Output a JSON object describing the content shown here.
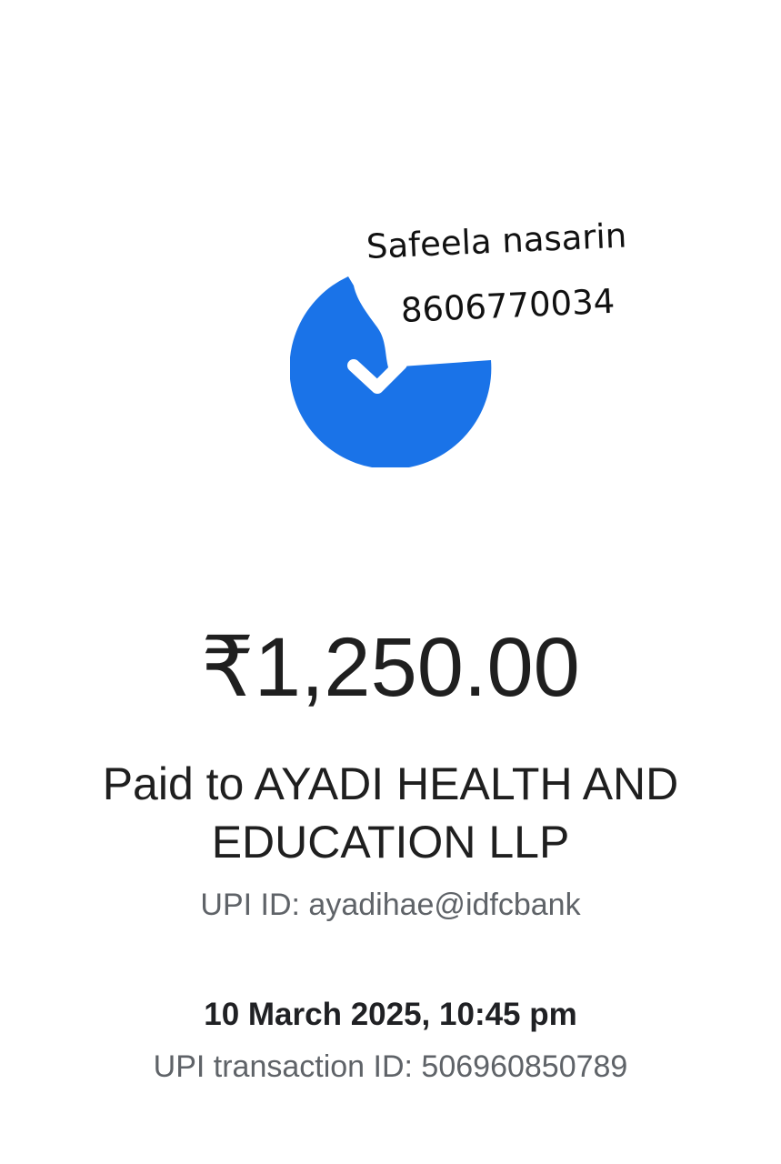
{
  "status": {
    "icon": "check-circle-icon",
    "accent_color": "#1A73E8"
  },
  "annotation": {
    "name": "Safeela nasarin",
    "phone": "8606770034"
  },
  "payment": {
    "amount": "₹1,250.00",
    "paid_to": "Paid to AYADI HEALTH AND EDUCATION LLP",
    "upi_id": "UPI ID: ayadihae@idfcbank",
    "datetime": "10 March 2025, 10:45 pm",
    "transaction_id": "UPI transaction ID: 506960850789"
  }
}
